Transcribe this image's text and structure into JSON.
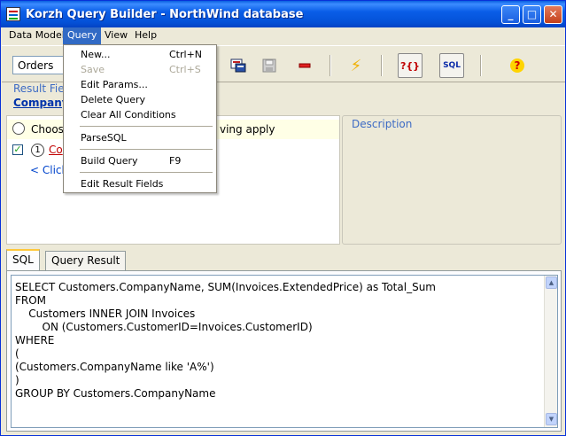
{
  "window": {
    "title": "Korzh Query Builder - NorthWind database",
    "minimize": "_",
    "maximize": "□",
    "close": "✕"
  },
  "menubar": {
    "items": [
      "Data Model",
      "Query",
      "View",
      "Help"
    ],
    "active": "Query"
  },
  "toolbar": {
    "entity": "Orders",
    "help_glyph": "?",
    "sql_glyph": "SQL",
    "params_glyph": "?{}",
    "run_glyph": "⚡"
  },
  "query_menu": {
    "items": [
      {
        "label": "New...",
        "shortcut": "Ctrl+N",
        "enabled": true
      },
      {
        "label": "Save",
        "shortcut": "Ctrl+S",
        "enabled": false
      },
      {
        "label": "Edit Params...",
        "shortcut": "",
        "enabled": true
      },
      {
        "label": "Delete Query",
        "shortcut": "",
        "enabled": true
      },
      {
        "label": "Clear All Conditions",
        "shortcut": "",
        "enabled": true
      },
      {
        "label": "ParseSQL",
        "shortcut": "",
        "enabled": true
      },
      {
        "label": "Build Query",
        "shortcut": "F9",
        "enabled": true
      },
      {
        "label": "Edit Result Fields",
        "shortcut": "",
        "enabled": true
      }
    ]
  },
  "result_fields": {
    "label": "Result Fie",
    "first_field": "Company"
  },
  "conditions": {
    "choose_text": "Choos",
    "apply_text": "ving apply",
    "condition_number": "1",
    "condition_link": "Co",
    "add_hint": "< Click"
  },
  "description": {
    "label": "Description"
  },
  "tabs": [
    {
      "label": "SQL",
      "active": true
    },
    {
      "label": "Query Result",
      "active": false
    }
  ],
  "sql": {
    "lines": [
      "SELECT Customers.CompanyName, SUM(Invoices.ExtendedPrice) as Total_Sum",
      "FROM",
      "    Customers INNER JOIN Invoices",
      "        ON (Customers.CustomerID=Invoices.CustomerID)",
      "WHERE",
      "(",
      "(Customers.CompanyName like 'A%')",
      ")",
      "GROUP BY Customers.CompanyName"
    ]
  }
}
